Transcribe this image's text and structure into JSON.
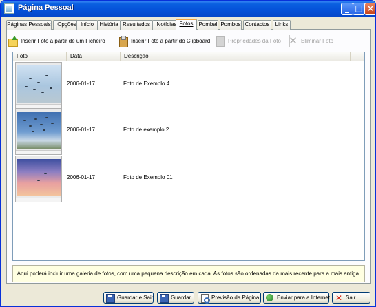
{
  "window": {
    "title": "Página Pessoal"
  },
  "tabs": [
    {
      "label": "Páginas Pessoais"
    },
    {
      "label": "Opções"
    },
    {
      "label": "Início"
    },
    {
      "label": "História"
    },
    {
      "label": "Resultados"
    },
    {
      "label": "Notícias"
    },
    {
      "label": "Fotos",
      "active": true
    },
    {
      "label": "Pombal"
    },
    {
      "label": "Pombos"
    },
    {
      "label": "Contactos"
    },
    {
      "label": "Links"
    }
  ],
  "toolbar": {
    "insert_file": "Inserir Foto a partir de um Ficheiro",
    "insert_clipboard": "Inserir Foto a partir do Clipboard",
    "properties": "Propriedades da Foto",
    "delete": "Eliminar Foto"
  },
  "table": {
    "columns": [
      "Foto",
      "Data",
      "Descrição"
    ],
    "rows": [
      {
        "date": "2006-01-17",
        "description": "Foto de Exemplo 4"
      },
      {
        "date": "2006-01-17",
        "description": "Foto de exemplo 2"
      },
      {
        "date": "2006-01-17",
        "description": "Foto de Exemplo 01"
      }
    ]
  },
  "info": "Aqui poderá incluir uma galeria de fotos, com uma pequena descrição em cada. As fotos são ordenadas da mais recente para a mais antiga.",
  "buttons": {
    "save_exit": "Guardar e Sair",
    "save": "Guardar",
    "preview": "Previsão da Página",
    "send": "Enviar para a Internet",
    "exit": "Sair"
  },
  "icons": {
    "app": "window-icon",
    "insert_file": "folder-add-icon",
    "insert_clipboard": "clipboard-icon",
    "properties": "properties-icon",
    "delete": "x-icon",
    "save": "floppy-disk-icon",
    "preview": "magnifier-icon",
    "send": "globe-icon",
    "exit": "x-icon"
  },
  "colors": {
    "titlebar": "#0450d8",
    "active_tab_accent": "#f6a73e",
    "info_background": "#ffffe1",
    "exit_icon": "#d02010"
  }
}
